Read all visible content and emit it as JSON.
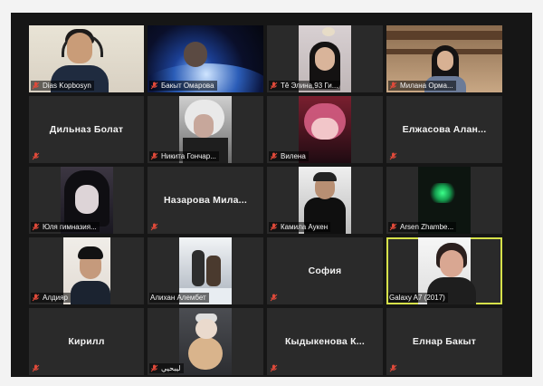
{
  "accent": "#d6e14a",
  "mute_icon_color": "#e04a3a",
  "participants": [
    {
      "name": "Dias Kopbosyn"
    },
    {
      "name": "Бакыт Омарова"
    },
    {
      "name": "Tê Элина,93 Ги..."
    },
    {
      "name": "Милана Орма..."
    },
    {
      "name": "Дильназ Болат"
    },
    {
      "name": "Никита Гончар..."
    },
    {
      "name": "Вилена"
    },
    {
      "name": "Елжасова Алан..."
    },
    {
      "name": "Юля гимназия..."
    },
    {
      "name": "Назарова Мила..."
    },
    {
      "name": "Камила Аукен"
    },
    {
      "name": "Arsen Zhambe..."
    },
    {
      "name": "Алдияр"
    },
    {
      "name": "Алихан Алембет"
    },
    {
      "name": "София"
    },
    {
      "name": "Galaxy A7 (2017)"
    },
    {
      "name": "Кирилл"
    },
    {
      "name": "ليبحيي"
    },
    {
      "name": "Кыдыкенова К..."
    },
    {
      "name": "Елнар Бакыт"
    }
  ]
}
